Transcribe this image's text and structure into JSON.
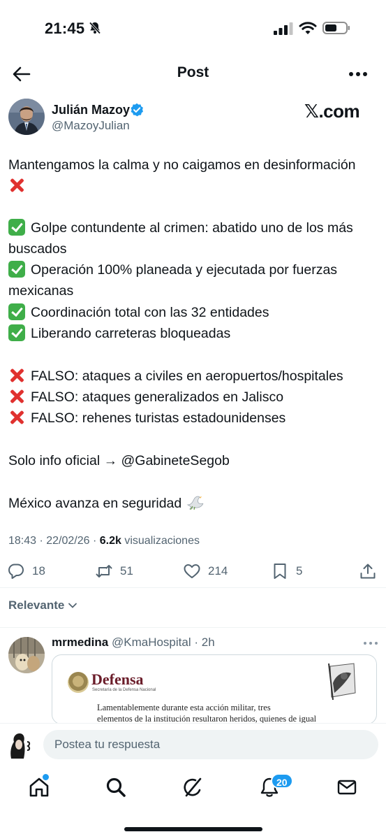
{
  "status_bar": {
    "time": "21:45",
    "battery_icon": "battery-icon"
  },
  "header": {
    "title": "Post"
  },
  "author": {
    "name": "Julián Mazoy",
    "handle": "@MazoyJulian",
    "verified_color": "#1d9bf0",
    "watermark": "X.com",
    "watermark_x": "𝕏",
    "watermark_rest": ".com"
  },
  "tweet": {
    "lines": [
      {
        "emoji": "",
        "text": "Mantengamos la calma y no caigamos en desinformación"
      },
      {
        "emoji": "x",
        "text": ""
      },
      {
        "emoji": "check",
        "text": "Golpe contundente al crimen: abatido uno de los más"
      },
      {
        "emoji": "",
        "text": "buscados"
      },
      {
        "emoji": "check",
        "text": "Operación 100% planeada y ejecutada por fuerzas"
      },
      {
        "emoji": "",
        "text": "mexicanas"
      },
      {
        "emoji": "check",
        "text": "Coordinación total con las 32 entidades"
      },
      {
        "emoji": "check",
        "text": "Liberando carreteras bloqueadas"
      },
      {
        "emoji": "x",
        "text": "FALSO: ataques a civiles en aeropuertos/hospitales"
      },
      {
        "emoji": "x",
        "text": "FALSO: ataques generalizados en Jalisco"
      },
      {
        "emoji": "x",
        "text": "FALSO: rehenes turistas estadounidenses"
      },
      {
        "emoji": "",
        "text": "Solo info oficial → @GabineteSegob"
      },
      {
        "emoji": "dove",
        "text": "México avanza en seguridad"
      }
    ],
    "time": "18:43 · 22/02/26 · ",
    "views": "6.2k",
    "views_label": " visualizaciones"
  },
  "actions": {
    "replies": "18",
    "reposts": "51",
    "likes": "214",
    "bookmarks": "5"
  },
  "sort": {
    "label": "Relevante"
  },
  "reply": {
    "name": "mrmedina",
    "handle": "@KmaHospital",
    "time": "· 2h",
    "card": {
      "title": "Defensa",
      "subtitle": "Secretaría de la Defensa Nacional",
      "line1": "Lamentablemente   durante   esta   acción   militar,   tres",
      "line2": "elementos de la institución resultaron heridos, quienes de igual"
    }
  },
  "composer": {
    "placeholder": "Postea tu respuesta"
  },
  "tabbar": {
    "notifications_badge": "20"
  },
  "colors": {
    "accent": "#1d9bf0",
    "text_secondary": "#536471",
    "check": "#3fae49",
    "cross": "#e0312f"
  }
}
